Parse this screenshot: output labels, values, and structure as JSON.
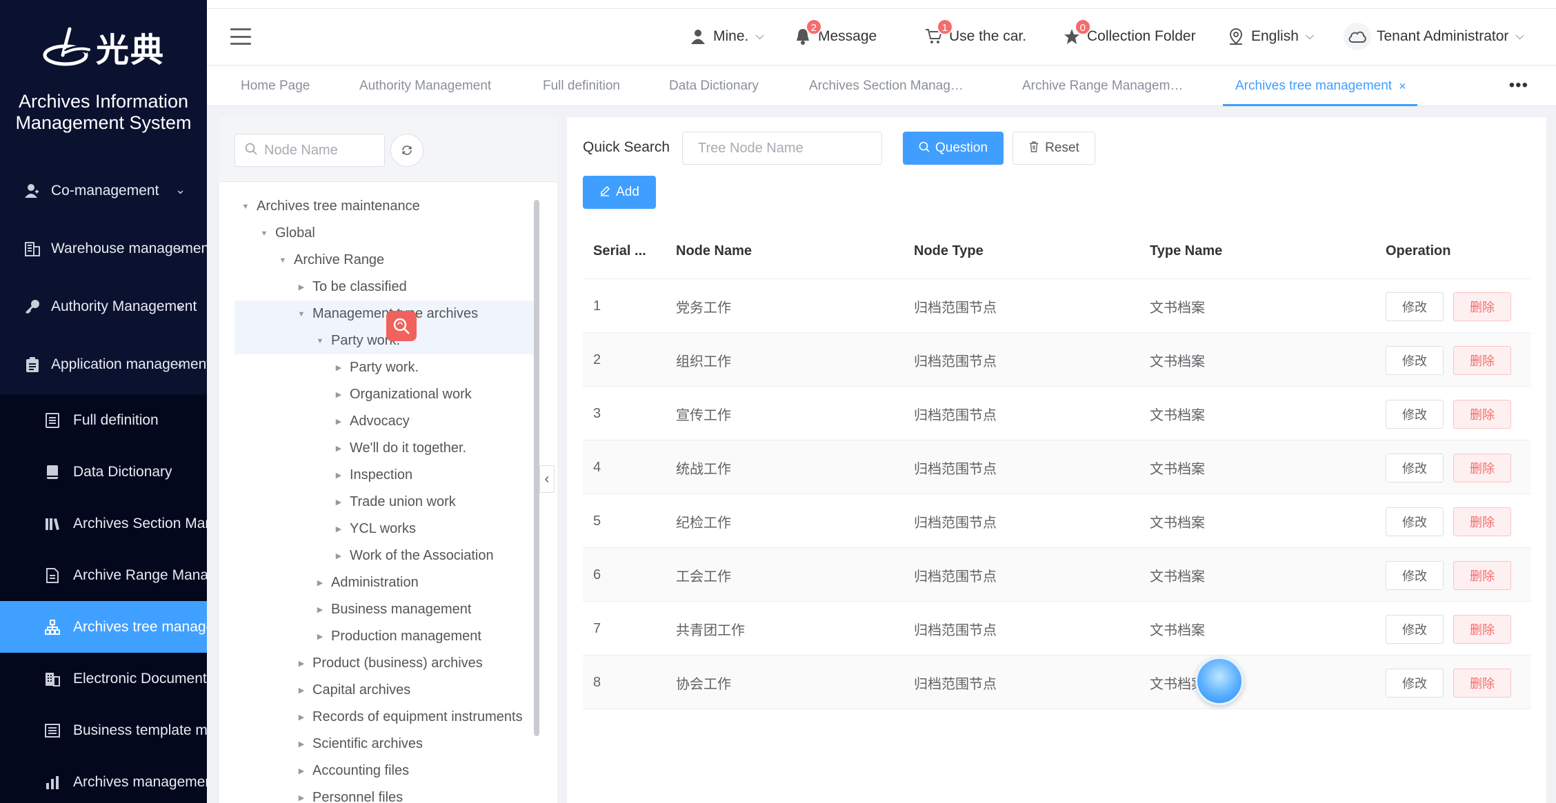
{
  "app": {
    "logo_text": "光典",
    "system_title": "Archives Information Management System"
  },
  "sidebar": {
    "items": [
      {
        "label": "Co-management",
        "icon": "user-manage-icon"
      },
      {
        "label": "Warehouse management",
        "icon": "warehouse-icon"
      },
      {
        "label": "Authority Management",
        "icon": "key-icon"
      },
      {
        "label": "Application management",
        "icon": "clipboard-icon"
      }
    ],
    "subitems": [
      {
        "label": "Full definition",
        "icon": "document-icon"
      },
      {
        "label": "Data Dictionary",
        "icon": "book-icon"
      },
      {
        "label": "Archives Section Management",
        "icon": "books-icon"
      },
      {
        "label": "Archive Range Management",
        "icon": "file-icon"
      },
      {
        "label": "Archives tree management",
        "icon": "tree-icon",
        "active": true
      },
      {
        "label": "Electronic Documents",
        "icon": "building-icon"
      },
      {
        "label": "Business template management",
        "icon": "template-icon"
      },
      {
        "label": "Archives management",
        "icon": "chart-icon"
      }
    ]
  },
  "header": {
    "user": "Mine.",
    "message": {
      "label": "Message",
      "badge": "2"
    },
    "car": {
      "label": "Use the car.",
      "badge": "1"
    },
    "collection": {
      "label": "Collection Folder",
      "badge": "0"
    },
    "language": "English",
    "tenant": "Tenant Administrator"
  },
  "tabs": [
    {
      "label": "Home Page"
    },
    {
      "label": "Authority Management"
    },
    {
      "label": "Full definition"
    },
    {
      "label": "Data Dictionary"
    },
    {
      "label": "Archives Section Manag…"
    },
    {
      "label": "Archive Range Managem…"
    },
    {
      "label": "Archives tree management",
      "active": true
    }
  ],
  "tree_panel": {
    "search_placeholder": "Node Name",
    "nodes": [
      {
        "label": "Archives tree maintenance",
        "level": 0,
        "expanded": true
      },
      {
        "label": "Global",
        "level": 1,
        "expanded": true
      },
      {
        "label": "Archive Range",
        "level": 2,
        "expanded": true
      },
      {
        "label": "To be classified",
        "level": 3,
        "expanded": false
      },
      {
        "label": "Management type archives",
        "level": 3,
        "expanded": true,
        "highlight": true
      },
      {
        "label": "Party work.",
        "level": 4,
        "expanded": true,
        "highlight": true
      },
      {
        "label": "Party work.",
        "level": 5,
        "expanded": false
      },
      {
        "label": "Organizational work",
        "level": 5,
        "expanded": false
      },
      {
        "label": "Advocacy",
        "level": 5,
        "expanded": false
      },
      {
        "label": "We'll do it together.",
        "level": 5,
        "expanded": false
      },
      {
        "label": "Inspection",
        "level": 5,
        "expanded": false
      },
      {
        "label": "Trade union work",
        "level": 5,
        "expanded": false
      },
      {
        "label": "YCL works",
        "level": 5,
        "expanded": false
      },
      {
        "label": "Work of the Association",
        "level": 5,
        "expanded": false
      },
      {
        "label": "Administration",
        "level": 4,
        "expanded": false
      },
      {
        "label": "Business management",
        "level": 4,
        "expanded": false
      },
      {
        "label": "Production management",
        "level": 4,
        "expanded": false
      },
      {
        "label": "Product (business) archives",
        "level": 3,
        "expanded": false
      },
      {
        "label": "Capital archives",
        "level": 3,
        "expanded": false
      },
      {
        "label": "Records of equipment instruments",
        "level": 3,
        "expanded": false
      },
      {
        "label": "Scientific archives",
        "level": 3,
        "expanded": false
      },
      {
        "label": "Accounting files",
        "level": 3,
        "expanded": false
      },
      {
        "label": "Personnel files",
        "level": 3,
        "expanded": false
      }
    ]
  },
  "search": {
    "label": "Quick Search",
    "placeholder": "Tree Node Name",
    "question_btn": "Question",
    "reset_btn": "Reset",
    "add_btn": "Add"
  },
  "table": {
    "columns": [
      "Serial ...",
      "Node Name",
      "Node Type",
      "Type Name",
      "Operation"
    ],
    "edit_label": "修改",
    "delete_label": "删除",
    "rows": [
      {
        "serial": "1",
        "node_name": "党务工作",
        "node_type": "归档范围节点",
        "type_name": "文书档案"
      },
      {
        "serial": "2",
        "node_name": "组织工作",
        "node_type": "归档范围节点",
        "type_name": "文书档案"
      },
      {
        "serial": "3",
        "node_name": "宣传工作",
        "node_type": "归档范围节点",
        "type_name": "文书档案"
      },
      {
        "serial": "4",
        "node_name": "统战工作",
        "node_type": "归档范围节点",
        "type_name": "文书档案"
      },
      {
        "serial": "5",
        "node_name": "纪检工作",
        "node_type": "归档范围节点",
        "type_name": "文书档案"
      },
      {
        "serial": "6",
        "node_name": "工会工作",
        "node_type": "归档范围节点",
        "type_name": "文书档案"
      },
      {
        "serial": "7",
        "node_name": "共青团工作",
        "node_type": "归档范围节点",
        "type_name": "文书档案"
      },
      {
        "serial": "8",
        "node_name": "协会工作",
        "node_type": "归档范围节点",
        "type_name": "文书档案"
      }
    ]
  },
  "colors": {
    "sidebar_bg": "#0b1230",
    "accent": "#409eff",
    "danger": "#f56c6c"
  }
}
